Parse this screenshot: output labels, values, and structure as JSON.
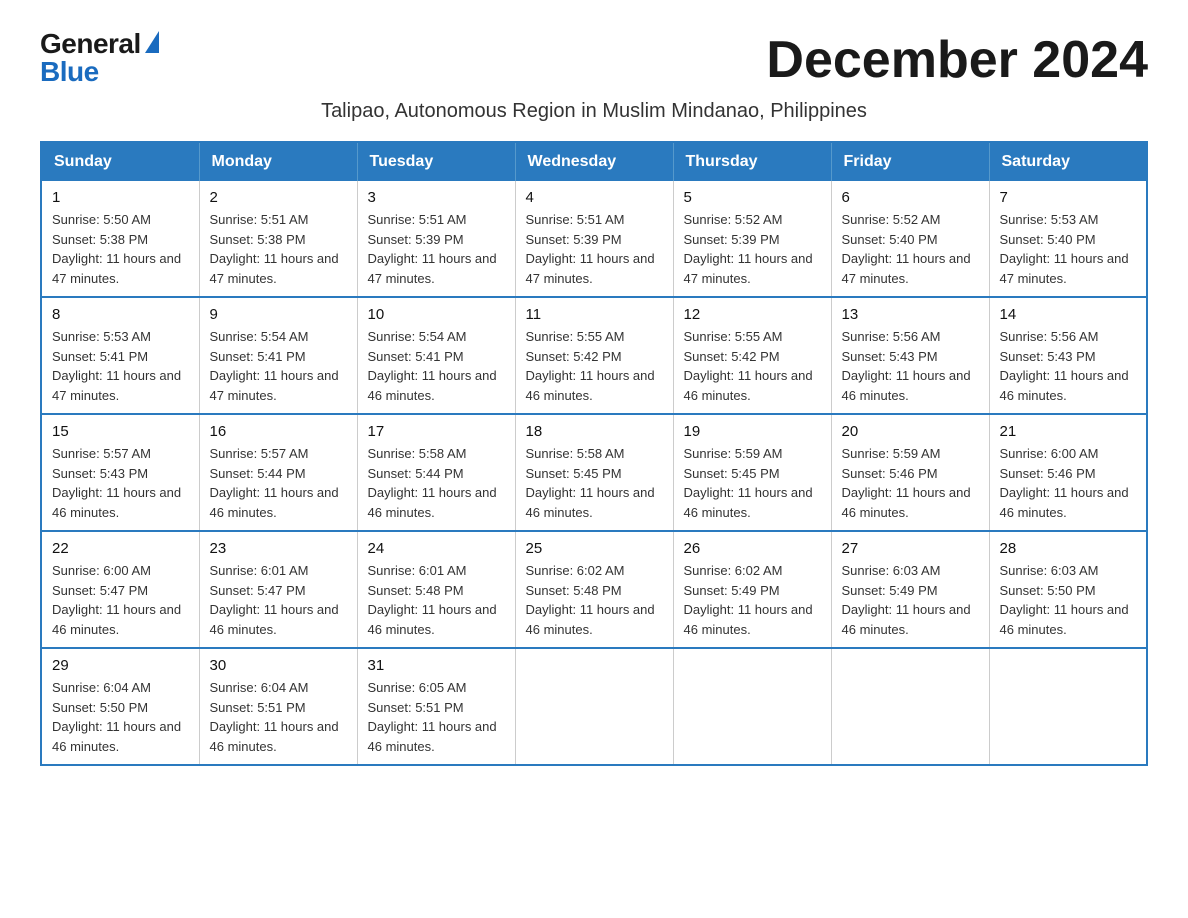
{
  "logo": {
    "general": "General",
    "blue": "Blue"
  },
  "title": "December 2024",
  "subtitle": "Talipao, Autonomous Region in Muslim Mindanao, Philippines",
  "calendar": {
    "headers": [
      "Sunday",
      "Monday",
      "Tuesday",
      "Wednesday",
      "Thursday",
      "Friday",
      "Saturday"
    ],
    "weeks": [
      [
        {
          "day": "1",
          "sunrise": "5:50 AM",
          "sunset": "5:38 PM",
          "daylight": "11 hours and 47 minutes."
        },
        {
          "day": "2",
          "sunrise": "5:51 AM",
          "sunset": "5:38 PM",
          "daylight": "11 hours and 47 minutes."
        },
        {
          "day": "3",
          "sunrise": "5:51 AM",
          "sunset": "5:39 PM",
          "daylight": "11 hours and 47 minutes."
        },
        {
          "day": "4",
          "sunrise": "5:51 AM",
          "sunset": "5:39 PM",
          "daylight": "11 hours and 47 minutes."
        },
        {
          "day": "5",
          "sunrise": "5:52 AM",
          "sunset": "5:39 PM",
          "daylight": "11 hours and 47 minutes."
        },
        {
          "day": "6",
          "sunrise": "5:52 AM",
          "sunset": "5:40 PM",
          "daylight": "11 hours and 47 minutes."
        },
        {
          "day": "7",
          "sunrise": "5:53 AM",
          "sunset": "5:40 PM",
          "daylight": "11 hours and 47 minutes."
        }
      ],
      [
        {
          "day": "8",
          "sunrise": "5:53 AM",
          "sunset": "5:41 PM",
          "daylight": "11 hours and 47 minutes."
        },
        {
          "day": "9",
          "sunrise": "5:54 AM",
          "sunset": "5:41 PM",
          "daylight": "11 hours and 47 minutes."
        },
        {
          "day": "10",
          "sunrise": "5:54 AM",
          "sunset": "5:41 PM",
          "daylight": "11 hours and 46 minutes."
        },
        {
          "day": "11",
          "sunrise": "5:55 AM",
          "sunset": "5:42 PM",
          "daylight": "11 hours and 46 minutes."
        },
        {
          "day": "12",
          "sunrise": "5:55 AM",
          "sunset": "5:42 PM",
          "daylight": "11 hours and 46 minutes."
        },
        {
          "day": "13",
          "sunrise": "5:56 AM",
          "sunset": "5:43 PM",
          "daylight": "11 hours and 46 minutes."
        },
        {
          "day": "14",
          "sunrise": "5:56 AM",
          "sunset": "5:43 PM",
          "daylight": "11 hours and 46 minutes."
        }
      ],
      [
        {
          "day": "15",
          "sunrise": "5:57 AM",
          "sunset": "5:43 PM",
          "daylight": "11 hours and 46 minutes."
        },
        {
          "day": "16",
          "sunrise": "5:57 AM",
          "sunset": "5:44 PM",
          "daylight": "11 hours and 46 minutes."
        },
        {
          "day": "17",
          "sunrise": "5:58 AM",
          "sunset": "5:44 PM",
          "daylight": "11 hours and 46 minutes."
        },
        {
          "day": "18",
          "sunrise": "5:58 AM",
          "sunset": "5:45 PM",
          "daylight": "11 hours and 46 minutes."
        },
        {
          "day": "19",
          "sunrise": "5:59 AM",
          "sunset": "5:45 PM",
          "daylight": "11 hours and 46 minutes."
        },
        {
          "day": "20",
          "sunrise": "5:59 AM",
          "sunset": "5:46 PM",
          "daylight": "11 hours and 46 minutes."
        },
        {
          "day": "21",
          "sunrise": "6:00 AM",
          "sunset": "5:46 PM",
          "daylight": "11 hours and 46 minutes."
        }
      ],
      [
        {
          "day": "22",
          "sunrise": "6:00 AM",
          "sunset": "5:47 PM",
          "daylight": "11 hours and 46 minutes."
        },
        {
          "day": "23",
          "sunrise": "6:01 AM",
          "sunset": "5:47 PM",
          "daylight": "11 hours and 46 minutes."
        },
        {
          "day": "24",
          "sunrise": "6:01 AM",
          "sunset": "5:48 PM",
          "daylight": "11 hours and 46 minutes."
        },
        {
          "day": "25",
          "sunrise": "6:02 AM",
          "sunset": "5:48 PM",
          "daylight": "11 hours and 46 minutes."
        },
        {
          "day": "26",
          "sunrise": "6:02 AM",
          "sunset": "5:49 PM",
          "daylight": "11 hours and 46 minutes."
        },
        {
          "day": "27",
          "sunrise": "6:03 AM",
          "sunset": "5:49 PM",
          "daylight": "11 hours and 46 minutes."
        },
        {
          "day": "28",
          "sunrise": "6:03 AM",
          "sunset": "5:50 PM",
          "daylight": "11 hours and 46 minutes."
        }
      ],
      [
        {
          "day": "29",
          "sunrise": "6:04 AM",
          "sunset": "5:50 PM",
          "daylight": "11 hours and 46 minutes."
        },
        {
          "day": "30",
          "sunrise": "6:04 AM",
          "sunset": "5:51 PM",
          "daylight": "11 hours and 46 minutes."
        },
        {
          "day": "31",
          "sunrise": "6:05 AM",
          "sunset": "5:51 PM",
          "daylight": "11 hours and 46 minutes."
        },
        null,
        null,
        null,
        null
      ]
    ]
  }
}
